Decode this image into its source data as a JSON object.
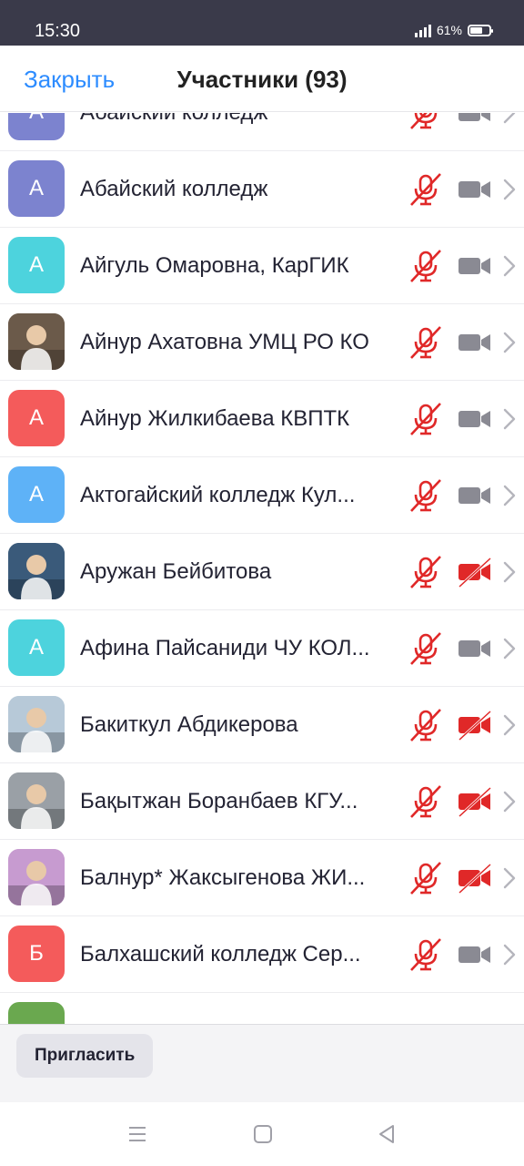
{
  "status_bar": {
    "time": "15:30",
    "battery": "61%"
  },
  "header": {
    "close_label": "Закрыть",
    "title": "Участники (93)"
  },
  "colors": {
    "accent": "#2d8cff",
    "muted_red": "#e02828",
    "cam_gray": "#8a8a93"
  },
  "participants": [
    {
      "initial": "А",
      "name": "Абайский колледж",
      "avatar_color": "#7c83cf",
      "photo": false,
      "video_off": false
    },
    {
      "initial": "А",
      "name": "Абайский колледж",
      "avatar_color": "#7c83cf",
      "photo": false,
      "video_off": false
    },
    {
      "initial": "А",
      "name": "Айгуль Омаровна, КарГИК",
      "avatar_color": "#4dd3dd",
      "photo": false,
      "video_off": false
    },
    {
      "initial": "",
      "name": "Айнур Ахатовна УМЦ РО КО",
      "avatar_color": "#6b5a4a",
      "photo": true,
      "video_off": false
    },
    {
      "initial": "А",
      "name": "Айнур Жилкибаева КВПТК",
      "avatar_color": "#f45b5b",
      "photo": false,
      "video_off": false
    },
    {
      "initial": "А",
      "name": "Актогайский колледж Кул...",
      "avatar_color": "#5eb2f7",
      "photo": false,
      "video_off": false
    },
    {
      "initial": "",
      "name": "Аружан Бейбитова",
      "avatar_color": "#3a5a7a",
      "photo": true,
      "video_off": true
    },
    {
      "initial": "А",
      "name": "Афина Пайсаниди ЧУ КОЛ...",
      "avatar_color": "#4dd3dd",
      "photo": false,
      "video_off": false
    },
    {
      "initial": "",
      "name": "Бакиткул Абдикерова",
      "avatar_color": "#b7c9d8",
      "photo": true,
      "video_off": true
    },
    {
      "initial": "",
      "name": "Бақытжан Боранбаев КГУ...",
      "avatar_color": "#9aa0a6",
      "photo": true,
      "video_off": true
    },
    {
      "initial": "",
      "name": "Балнур* Жаксыгенова ЖИ...",
      "avatar_color": "#c79bd0",
      "photo": true,
      "video_off": true
    },
    {
      "initial": "Б",
      "name": "Балхашский колледж Сер...",
      "avatar_color": "#f45b5b",
      "photo": false,
      "video_off": false
    },
    {
      "initial": "",
      "name": "",
      "avatar_color": "#6aa84f",
      "photo": false,
      "video_off": false
    }
  ],
  "footer": {
    "invite_label": "Пригласить"
  }
}
